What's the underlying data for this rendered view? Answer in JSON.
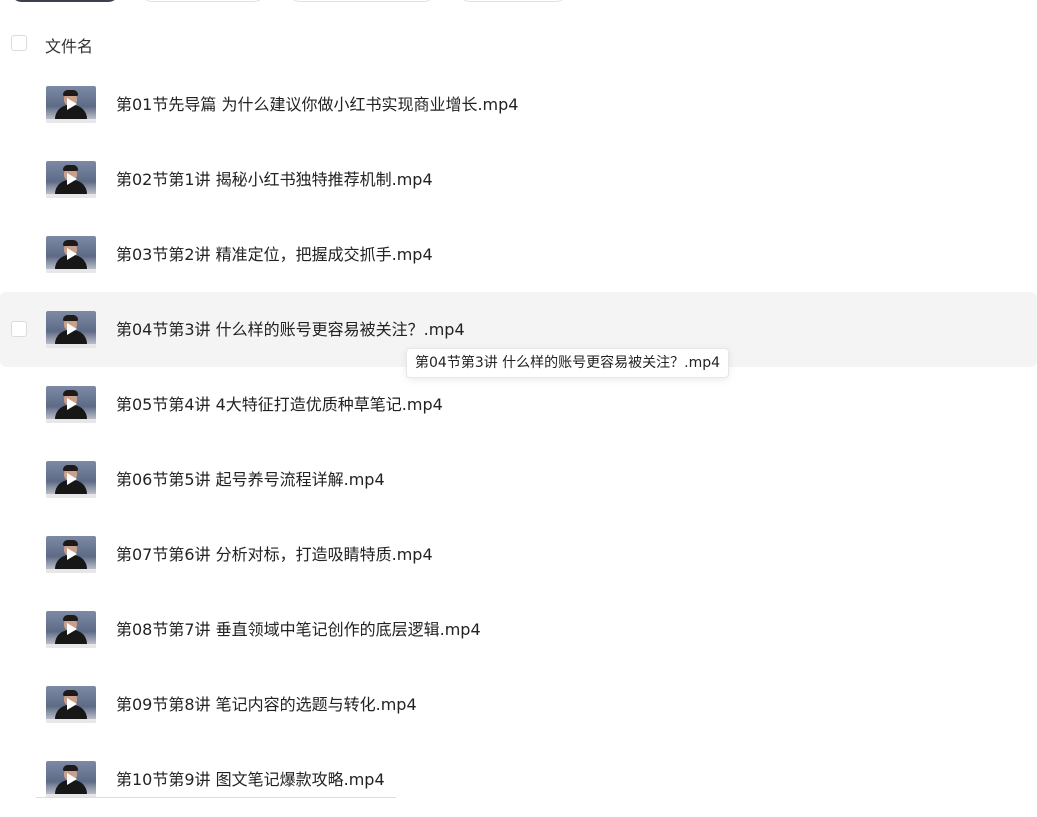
{
  "header": {
    "column_label": "文件名"
  },
  "files": [
    {
      "name": "第01节先导篇 为什么建议你做小红书实现商业增长.mp4"
    },
    {
      "name": "第02节第1讲 揭秘小红书独特推荐机制.mp4"
    },
    {
      "name": "第03节第2讲 精准定位，把握成交抓手.mp4"
    },
    {
      "name": "第04节第3讲 什么样的账号更容易被关注？.mp4"
    },
    {
      "name": "第05节第4讲 4大特征打造优质种草笔记.mp4"
    },
    {
      "name": "第06节第5讲 起号养号流程详解.mp4"
    },
    {
      "name": "第07节第6讲 分析对标，打造吸睛特质.mp4"
    },
    {
      "name": "第08节第7讲 垂直领域中笔记创作的底层逻辑.mp4"
    },
    {
      "name": "第09节第8讲 笔记内容的选题与转化.mp4"
    },
    {
      "name": "第10节第9讲 图文笔记爆款攻略.mp4"
    }
  ],
  "tooltip": {
    "text": "第04节第3讲 什么样的账号更容易被关注？.mp4"
  },
  "icons": {
    "thumbnail": "video-thumbnail-icon",
    "play": "play-icon"
  }
}
